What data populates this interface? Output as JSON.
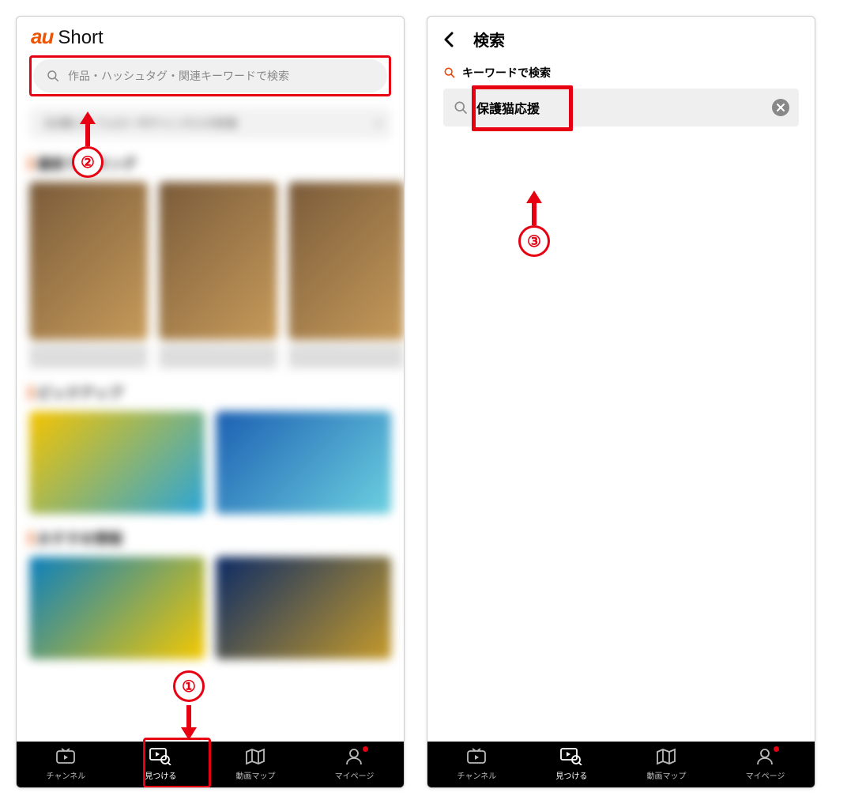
{
  "left": {
    "logo": {
      "au": "au",
      "short": "Short"
    },
    "search_placeholder": "作品・ハッシュタグ・関連キーワードで検索",
    "notice": "【お願い】フォロー中チャンネルの新着",
    "section_ranking": "最新ランキング",
    "section_pickup": "ピックアップ",
    "section_recommend": "おすすめ情報",
    "callouts": {
      "one": "①",
      "two": "②"
    }
  },
  "right": {
    "title": "検索",
    "keyword_label": "キーワードで検索",
    "input_value": "保護猫応援",
    "callout_three": "③"
  },
  "nav": {
    "channel": "チャンネル",
    "discover": "見つける",
    "map": "動画マップ",
    "mypage": "マイページ"
  }
}
